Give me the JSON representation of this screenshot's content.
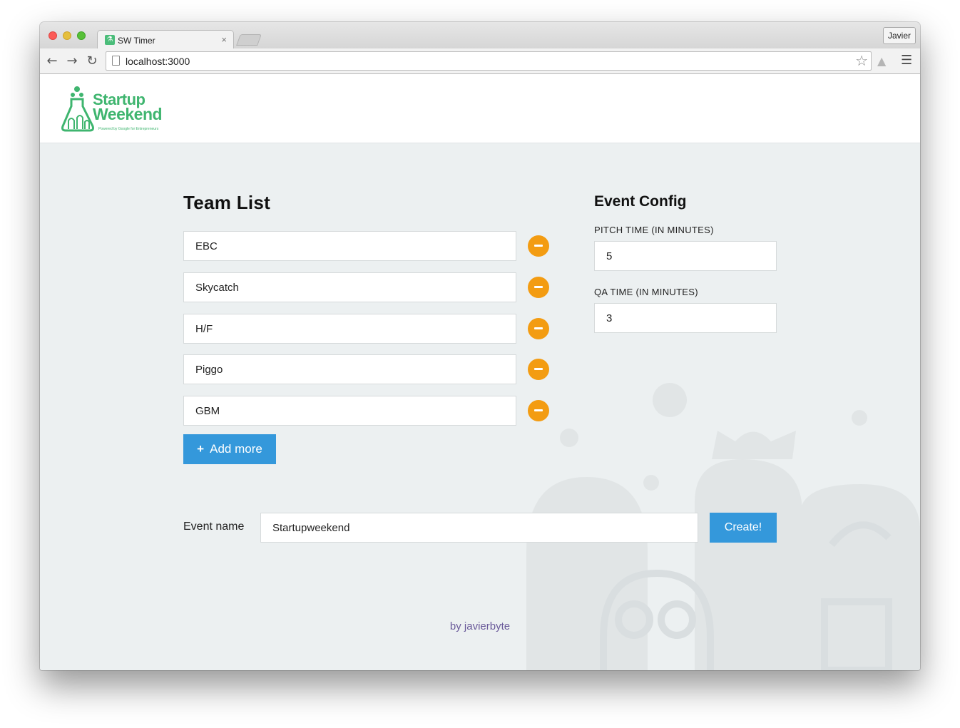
{
  "browser": {
    "tab_title": "SW Timer",
    "tab_close_glyph": "×",
    "profile_name": "Javier",
    "url": "localhost:3000",
    "icons": [
      "back-arrow-icon",
      "forward-arrow-icon",
      "reload-icon",
      "page-icon",
      "bookmark-star-icon",
      "drive-extension-icon",
      "menu-icon"
    ]
  },
  "header": {
    "logo_line1": "Startup",
    "logo_line2": "Weekend",
    "logo_tagline": "Powered by Google for Entrepreneurs",
    "brand_color": "#3fb56f"
  },
  "team_list": {
    "title": "Team List",
    "teams": [
      "EBC",
      "Skycatch",
      "H/F",
      "Piggo",
      "GBM"
    ],
    "remove_button_color": "#f39c12",
    "add_more_label": "Add more",
    "add_more_icon": "plus-icon"
  },
  "event_config": {
    "title": "Event Config",
    "pitch_label": "PITCH TIME (IN MINUTES)",
    "pitch_value": "5",
    "qa_label": "QA TIME (IN MINUTES)",
    "qa_value": "3"
  },
  "event": {
    "name_label": "Event name",
    "name_value": "Startupweekend",
    "create_label": "Create!"
  },
  "footer": {
    "credit": "by javierbyte"
  },
  "colors": {
    "accent_blue": "#3498db",
    "background": "#ecf0f1"
  }
}
